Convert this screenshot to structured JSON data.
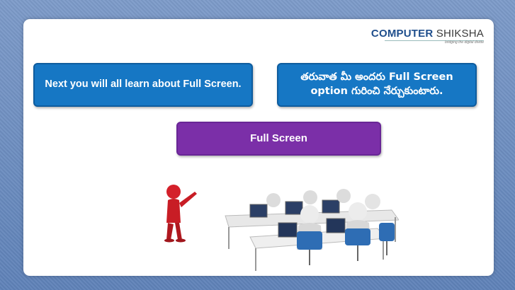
{
  "logo": {
    "brand_first": "COMPUTER",
    "brand_second": "SHIKSHA",
    "tagline": "bridging the digital divide"
  },
  "left_bubble": {
    "text": "Next you will all learn about Full Screen."
  },
  "right_bubble": {
    "text": "తరువాత మీ అందరు Full Screen option గురించి నేర్చుకుంటారు."
  },
  "title_bubble": {
    "text": "Full Screen"
  },
  "colors": {
    "blue_bubble": "#1677c4",
    "purple_bubble": "#7b2fa8",
    "background": "#6f8fbf"
  },
  "illustration": {
    "icon": "classroom-illustration-icon"
  }
}
